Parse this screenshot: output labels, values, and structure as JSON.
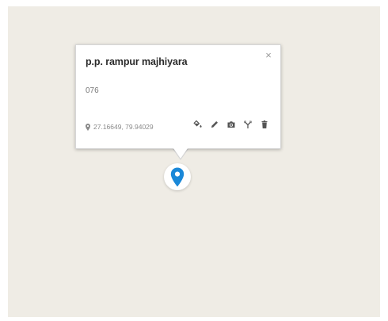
{
  "popup": {
    "title": "p.p. rampur majhiyara",
    "description": "076",
    "coordinates": "27.16649, 79.94029",
    "close_glyph": "×"
  },
  "icons": {
    "coords": "location-pin-icon",
    "tools": [
      "paint-bucket-icon",
      "pencil-icon",
      "camera-icon",
      "route-fork-icon",
      "trash-icon"
    ],
    "marker": "map-marker-icon"
  },
  "colors": {
    "map_background": "#efece5",
    "marker": "#1a88d8",
    "icon_gray": "#555555"
  }
}
